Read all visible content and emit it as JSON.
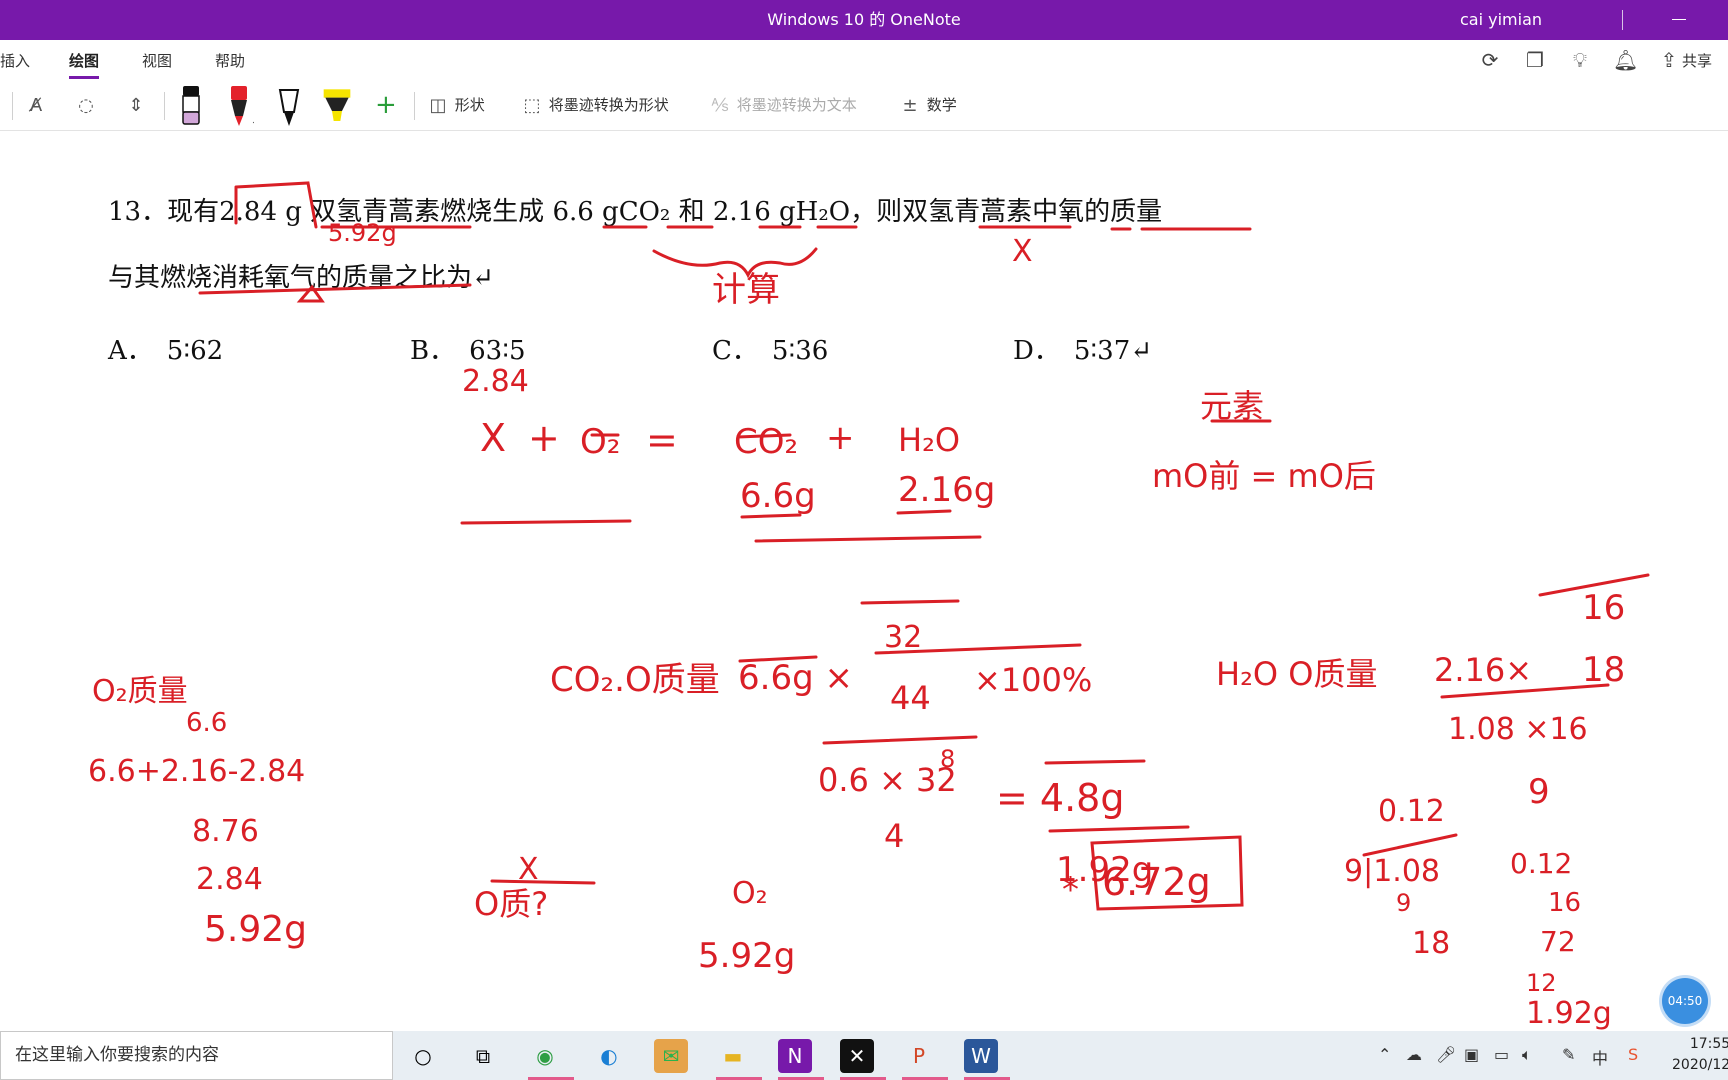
{
  "titlebar": {
    "title": "Windows 10 的 OneNote",
    "user": "cai yimian"
  },
  "ribbon": {
    "tabs": [
      "插入",
      "绘图",
      "视图",
      "帮助"
    ],
    "active_tab": "绘图",
    "share_label": "共享"
  },
  "toolbar": {
    "shapes_label": "形状",
    "ink_to_shape_label": "将墨迹转换为形状",
    "ink_to_text_label": "将墨迹转换为文本",
    "math_label": "数学",
    "pens": [
      {
        "name": "black-pen",
        "color": "#111111"
      },
      {
        "name": "red-pen",
        "color": "#e3222b"
      },
      {
        "name": "pencil",
        "color": "#222222"
      },
      {
        "name": "highlighter",
        "color": "#f5e400"
      }
    ]
  },
  "question": {
    "line1_prefix": "13．现有",
    "mass_a": "2.84 g",
    "line1_mid": " 双氢青蒿素燃烧生成 ",
    "mass_b": "6.6 gCO₂",
    "line1_and": " 和 ",
    "mass_c": "2.16 gH₂O",
    "line1_suffix": "，则双氢青蒿素中氧的质量",
    "line2": "与其燃烧消耗氧气的质量之比为↵",
    "options": [
      {
        "label": "A．",
        "value": "5∶62"
      },
      {
        "label": "B．",
        "value": "63∶5"
      },
      {
        "label": "C．",
        "value": "5∶36"
      },
      {
        "label": "D．",
        "value": "5∶37↵"
      }
    ]
  },
  "ink": {
    "color": "#d91f26",
    "notes": {
      "top_529": "5.92g",
      "calc": "计算",
      "x_mark": "X",
      "n284": "2.84",
      "eq_x": "X",
      "eq_plus1": "+",
      "eq_o2": "O₂",
      "eq_equals": "=",
      "eq_co2": "CO₂",
      "eq_plus2": "+",
      "eq_h2o": "H₂O",
      "m66": "6.6g",
      "m216": "2.16g",
      "yuansu": "元素",
      "mo_eq": "mO前 = mO后",
      "o2_mass": "O₂质量",
      "n66": "6.6",
      "sum": "6.6+2.16-2.84",
      "n876": "8.76",
      "n284b": "2.84",
      "n592": "5.92g",
      "co2_o": "CO₂.O质量",
      "co2_calc": "6.6g ×",
      "frac32": "32",
      "frac44": "44",
      "pct": "×100%",
      "h2o_o": "H₂O O质量",
      "h2o_calc": "2.16×",
      "frac16": "16",
      "frac18": "18",
      "calc_top": "0.6 × 32",
      "calc_8": "8",
      "calc_bot": "4",
      "eq48": "= 4.8g",
      "n192": "1.92g",
      "n672": "6.72g",
      "ostar": "*",
      "n108x16": "1.08 ×16",
      "n9": "9",
      "n012": "0.12",
      "div": "9|1.08",
      "div9": "9",
      "div18": "18",
      "c012": "0.12",
      "c16": "16",
      "c72": "72",
      "c12": "12",
      "c192": "1.92g",
      "o_q": "O质?",
      "o_x": "X",
      "o2b": "O₂",
      "o2b_val": "5.92g"
    }
  },
  "timer": "04:50",
  "taskbar": {
    "search_placeholder": "在这里输入你要搜索的内容",
    "time": "17:55",
    "date": "2020/12"
  }
}
